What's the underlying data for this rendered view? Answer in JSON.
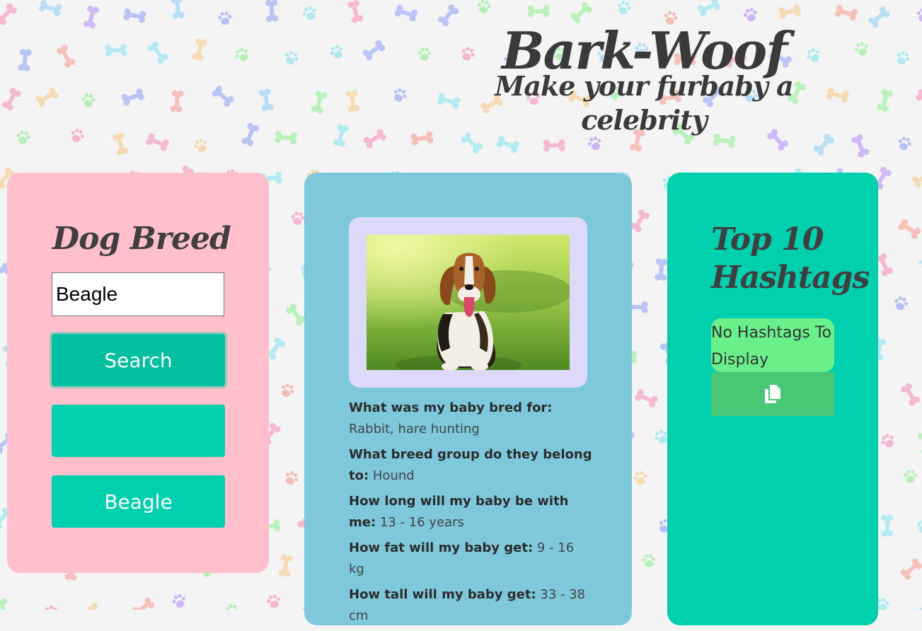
{
  "header": {
    "brand": "Bark-Woof",
    "tagline": "Make your furbaby a celebrity"
  },
  "search_panel": {
    "title": "Dog Breed",
    "input_value": "Beagle",
    "search_button": "Search",
    "blank_button": "",
    "result_button": "Beagle"
  },
  "breed_panel": {
    "facts": [
      {
        "question": "What was my baby bred for:",
        "answer": "Rabbit, hare hunting"
      },
      {
        "question": "What breed group do they belong to:",
        "answer": "Hound"
      },
      {
        "question": "How long will my baby be with me:",
        "answer": "13 - 16 years"
      },
      {
        "question": "How fat will my baby get:",
        "answer": "9 - 16 kg"
      },
      {
        "question": "How tall will my baby get:",
        "answer": "33 - 38 cm"
      }
    ]
  },
  "hashtags_panel": {
    "title": "Top 10 Hashtags",
    "empty_message": "No Hashtags To Display"
  },
  "colors": {
    "search_panel": "#ffc0cb",
    "breed_panel": "#7ec8dc",
    "hashtags_panel": "#00d0ad",
    "button": "#00d0ad",
    "hashtag_box": "#69f08a",
    "copy_button": "#48c774",
    "photo_frame": "#dcdaf8"
  },
  "icons": {
    "background_pattern": [
      "bone-icon",
      "paw-icon"
    ],
    "copy_button_icon": "copy-icon"
  }
}
